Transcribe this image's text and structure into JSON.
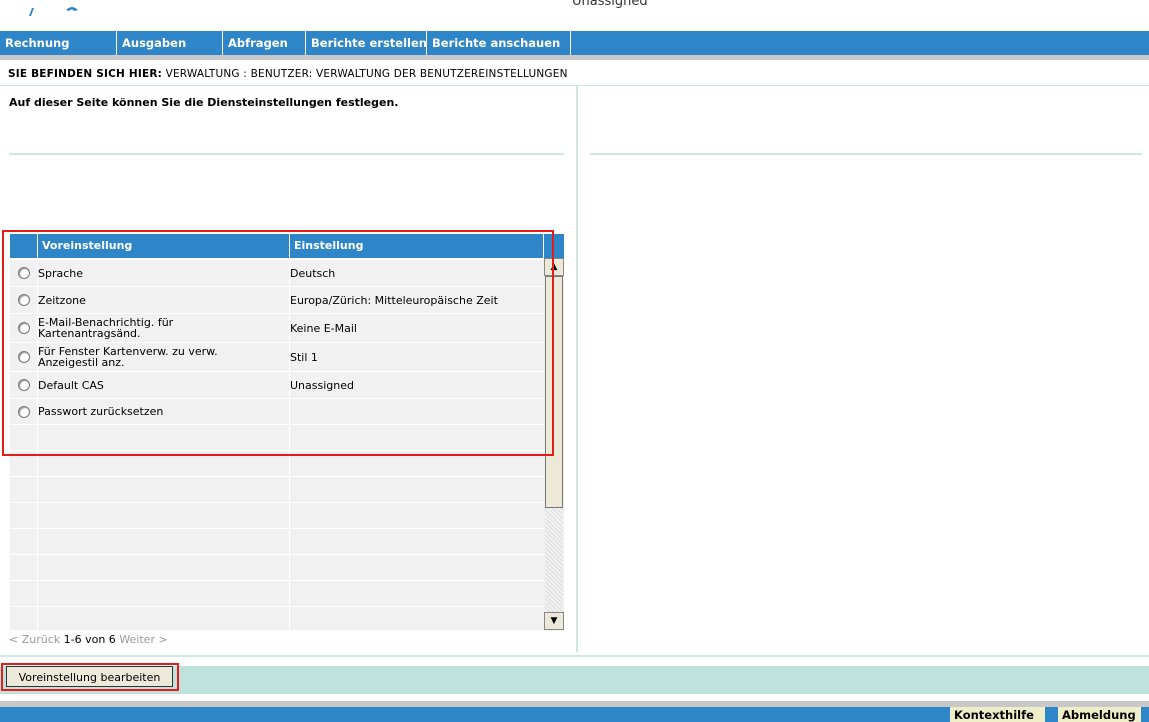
{
  "top": {
    "cas_label": "Unassigned"
  },
  "nav": {
    "items": [
      {
        "label": "Rechnung"
      },
      {
        "label": "Ausgaben"
      },
      {
        "label": "Abfragen"
      },
      {
        "label": "Berichte erstellen"
      },
      {
        "label": "Berichte anschauen"
      }
    ]
  },
  "breadcrumb": {
    "prefix": "SIE BEFINDEN SICH HIER:",
    "path": "VERWALTUNG : BENUTZER: VERWALTUNG DER BENUTZEREINSTELLUNGEN"
  },
  "intro": "Auf dieser Seite können Sie die Diensteinstellungen festlegen.",
  "table": {
    "headers": {
      "setting": "Voreinstellung",
      "value": "Einstellung"
    },
    "rows": [
      {
        "setting": "Sprache",
        "value": "Deutsch"
      },
      {
        "setting": "Zeitzone",
        "value": "Europa/Zürich: Mitteleuropäische Zeit"
      },
      {
        "setting": "E-Mail-Benachrichtig. für Kartenantragsänd.",
        "value": "Keine E-Mail"
      },
      {
        "setting": "Für Fenster Kartenverw. zu verw. Anzeigestil anz.",
        "value": "Stil 1"
      },
      {
        "setting": "Default CAS",
        "value": "Unassigned"
      },
      {
        "setting": "Passwort zurücksetzen",
        "value": ""
      }
    ]
  },
  "pager": {
    "prev": "< Zurück",
    "count": "1-6 von 6",
    "next": "Weiter >"
  },
  "actions": {
    "edit_button": "Voreinstellung bearbeiten"
  },
  "footer": {
    "help": "Kontexthilfe",
    "logout": "Abmeldung"
  },
  "colors": {
    "nav_blue": "#2e86c8",
    "panel_teal": "#bfe3dc",
    "highlight_red": "#e31c1c",
    "footer_button": "#eeeec8"
  }
}
